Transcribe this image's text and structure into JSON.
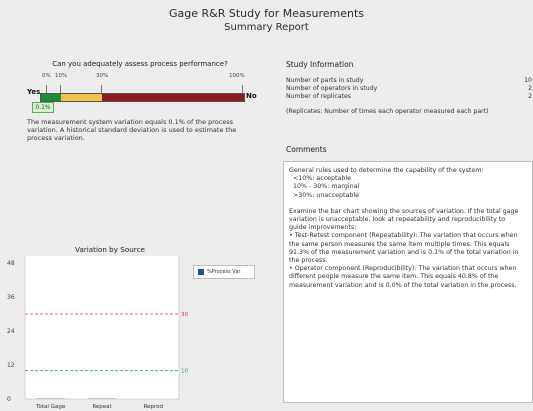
{
  "header": {
    "title": "Gage R&R Study for Measurements",
    "subtitle": "Summary Report"
  },
  "assessment": {
    "question": "Can you adequately assess process performance?",
    "ticks": [
      "0%",
      "10%",
      "30%",
      "100%"
    ],
    "yes_label": "Yes",
    "no_label": "No",
    "marker_label": "0.1%",
    "value_percent": 0.1,
    "colors": {
      "acceptable": "#1a8f3a",
      "marginal": "#f2c14e",
      "unacceptable": "#8e1c1e"
    },
    "description": "The measurement system variation equals 0.1% of the process variation. A historical standard deviation is used to estimate the process variation."
  },
  "study_info": {
    "title": "Study Information",
    "rows": [
      {
        "label": "Number of parts in study",
        "value": "10"
      },
      {
        "label": "Number of operators in study",
        "value": "2"
      },
      {
        "label": "Number of replicates",
        "value": "2"
      }
    ],
    "note": "(Replicates: Number of times each operator measured each part)"
  },
  "comments": {
    "title": "Comments",
    "rules_intro": "General rules used to determine the capability of the system:",
    "rules": [
      "<10%: acceptable",
      "10% - 30%: marginal",
      ">30%: unacceptable"
    ],
    "examine": "Examine the bar chart showing the sources of variation. If the total gage variation is unacceptable, look at repeatability and reproducibility to guide improvements:",
    "bullets": [
      "• Test-Retest component (Repeatability): The variation that occurs when the same person measures the same item multiple times. This equals 91.3% of the measurement variation and is 0.1% of the total variation in the process.",
      "• Operator component (Reproducibility): The variation that occurs when different people measure the same item. This equals 40.8% of the measurement variation and is 0.0% of the total variation in the process."
    ]
  },
  "chart_data": {
    "type": "bar",
    "title": "Variation by Source",
    "categories": [
      "Total Gage",
      "Repeat",
      "Reprod"
    ],
    "series": [
      {
        "name": "%Process Var",
        "values": [
          0.1,
          0.1,
          0.0
        ]
      }
    ],
    "ylim": [
      0,
      48
    ],
    "yticks": [
      "0",
      "12",
      "24",
      "36",
      "48"
    ],
    "reference_lines": [
      {
        "value": 30,
        "label": "30",
        "color": "#d9363a"
      },
      {
        "value": 10,
        "label": "10",
        "color": "#3aa04a"
      }
    ],
    "series_color": "#1f4ea0",
    "grid": false,
    "legend": "top-right"
  }
}
